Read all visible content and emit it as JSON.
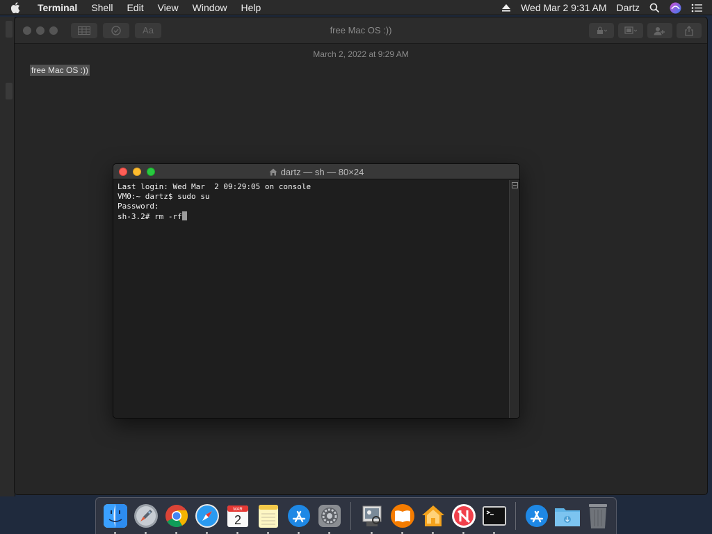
{
  "menubar": {
    "apple_icon": "apple-icon",
    "app_name": "Terminal",
    "menus": [
      "Shell",
      "Edit",
      "View",
      "Window",
      "Help"
    ],
    "datetime": "Wed Mar 2  9:31 AM",
    "user": "Dartz",
    "icons": [
      "eject-icon",
      "search-icon",
      "siri-icon",
      "control-center-icon"
    ]
  },
  "notes": {
    "title": "free Mac OS :))",
    "date": "March 2, 2022 at 9:29 AM",
    "body": "free Mac OS :))",
    "toolbar_buttons": [
      "list-view-icon",
      "checklist-icon",
      "format-icon"
    ],
    "toolbar_right_buttons": [
      "lock-icon",
      "gallery-icon",
      "share-people-icon",
      "share-icon"
    ]
  },
  "terminal": {
    "title": "dartz — sh — 80×24",
    "lines": [
      "Last login: Wed Mar  2 09:29:05 on console",
      "VM0:~ dartz$ sudo su",
      "Password:",
      "sh-3.2# rm -rf"
    ]
  },
  "dock": {
    "apps": [
      {
        "name": "Finder",
        "icon": "finder-icon",
        "running": true
      },
      {
        "name": "Launchpad",
        "icon": "launchpad-icon",
        "running": true
      },
      {
        "name": "Chrome",
        "icon": "chrome-icon",
        "running": true
      },
      {
        "name": "Safari",
        "icon": "safari-icon",
        "running": true
      },
      {
        "name": "Calendar",
        "icon": "calendar-icon",
        "running": true,
        "month": "MAR",
        "day": "2"
      },
      {
        "name": "Notes",
        "icon": "notes-icon",
        "running": true
      },
      {
        "name": "App Store",
        "icon": "app-store-icon",
        "running": true
      },
      {
        "name": "System Preferences",
        "icon": "system-preferences-icon",
        "running": true
      },
      {
        "name": "Preview",
        "icon": "preview-icon",
        "running": true
      },
      {
        "name": "Books",
        "icon": "books-icon",
        "running": true
      },
      {
        "name": "Home",
        "icon": "home-icon",
        "running": true
      },
      {
        "name": "News",
        "icon": "news-icon",
        "running": true
      },
      {
        "name": "Terminal",
        "icon": "terminal-icon",
        "running": true
      },
      {
        "name": "App Store",
        "icon": "app-store-icon",
        "running": false
      },
      {
        "name": "Downloads",
        "icon": "folder-icon",
        "running": false
      },
      {
        "name": "Trash",
        "icon": "trash-icon",
        "running": false
      }
    ]
  }
}
